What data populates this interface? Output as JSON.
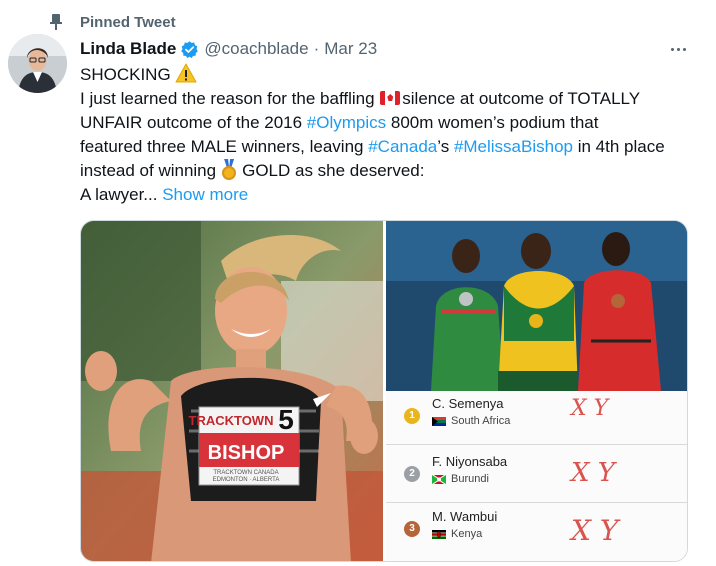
{
  "social_context": {
    "label": "Pinned Tweet",
    "icon": "pin-icon"
  },
  "author": {
    "name": "Linda Blade",
    "handle": "@coachblade",
    "separator": "·",
    "date": "Mar 23",
    "verified": true
  },
  "tweet": {
    "line1": "SHOCKING",
    "line2_a": "I just learned the reason for the baffling ",
    "line2_b": "silence  at outcome of TOTALLY",
    "line3_a": "UNFAIR outcome of the 2016 ",
    "tag_olympics": "#Olympics",
    "line3_b": " 800m women’s podium that",
    "line4_a": "featured three MALE winners, leaving ",
    "tag_canada": "#Canada",
    "line4_b": "’s ",
    "tag_bishop": "#MelissaBishop",
    "line4_c": " in 4th place",
    "line5_a": "instead of winning",
    "line5_b": "GOLD as she deserved:",
    "line6": "A lawyer...",
    "show_more": "Show more"
  },
  "media": {
    "left_photo": {
      "bib_top": "TRACKTOWN",
      "bib_number": "5",
      "bib_name": "BISHOP",
      "bib_bottom1": "TRACKTOWN CANADA",
      "bib_bottom2": "EDMONTON · ALBERTA"
    },
    "results": [
      {
        "rank": "1",
        "name": "C. Semenya",
        "country": "South Africa",
        "badge_color": "#e8b51c",
        "note": "X Y"
      },
      {
        "rank": "2",
        "name": "F. Niyonsaba",
        "country": "Burundi",
        "badge_color": "#9aa0a6",
        "note": "X Y"
      },
      {
        "rank": "3",
        "name": "M. Wambui",
        "country": "Kenya",
        "badge_color": "#b5653a",
        "note": "X Y"
      }
    ]
  },
  "colors": {
    "accent": "#1d9bf0",
    "text": "#0f1419",
    "secondary": "#536471",
    "annotation": "#d9534f"
  }
}
